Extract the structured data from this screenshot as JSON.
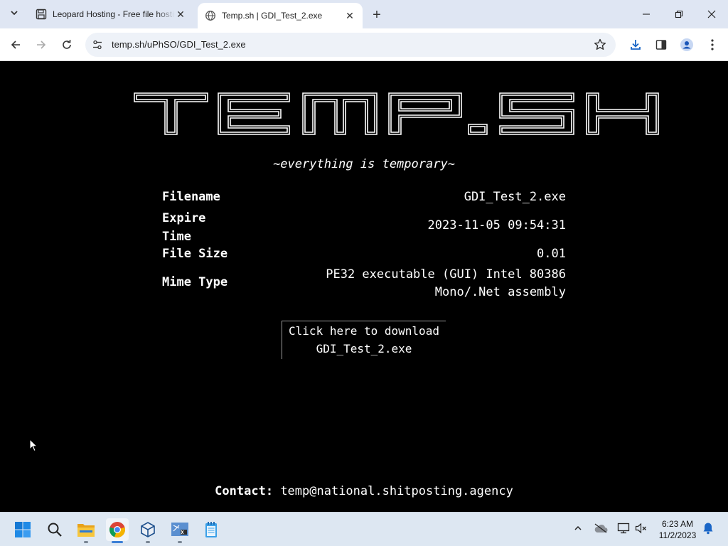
{
  "browser": {
    "tabs": [
      {
        "title": "Leopard Hosting - Free file hosting",
        "active": false
      },
      {
        "title": "Temp.sh | GDI_Test_2.exe",
        "active": true
      }
    ],
    "url": "temp.sh/uPhSO/GDI_Test_2.exe"
  },
  "page": {
    "logo_text": "TEMP.SH",
    "tagline": "~everything is temporary~",
    "info": [
      {
        "label": "Filename",
        "value": "GDI_Test_2.exe"
      },
      {
        "label_line1": "Expire",
        "label_line2": "Time",
        "value": "2023-11-05 09:54:31"
      },
      {
        "label": "File Size",
        "value": "0.01"
      },
      {
        "label": "Mime Type",
        "value_line1": "PE32 executable (GUI) Intel 80386",
        "value_line2": "Mono/.Net assembly"
      }
    ],
    "download": {
      "line1": "Click here to download",
      "line2": "GDI_Test_2.exe"
    },
    "contact": {
      "label": "Contact:",
      "email": "temp@national.shitposting.agency"
    }
  },
  "taskbar": {
    "apps": [
      "start-icon",
      "search-icon",
      "file-explorer-icon",
      "chrome-icon",
      "virtualbox-icon",
      "windows-xp-vm-icon",
      "notepad-icon"
    ],
    "time": "6:23 AM",
    "date": "11/2/2023"
  }
}
